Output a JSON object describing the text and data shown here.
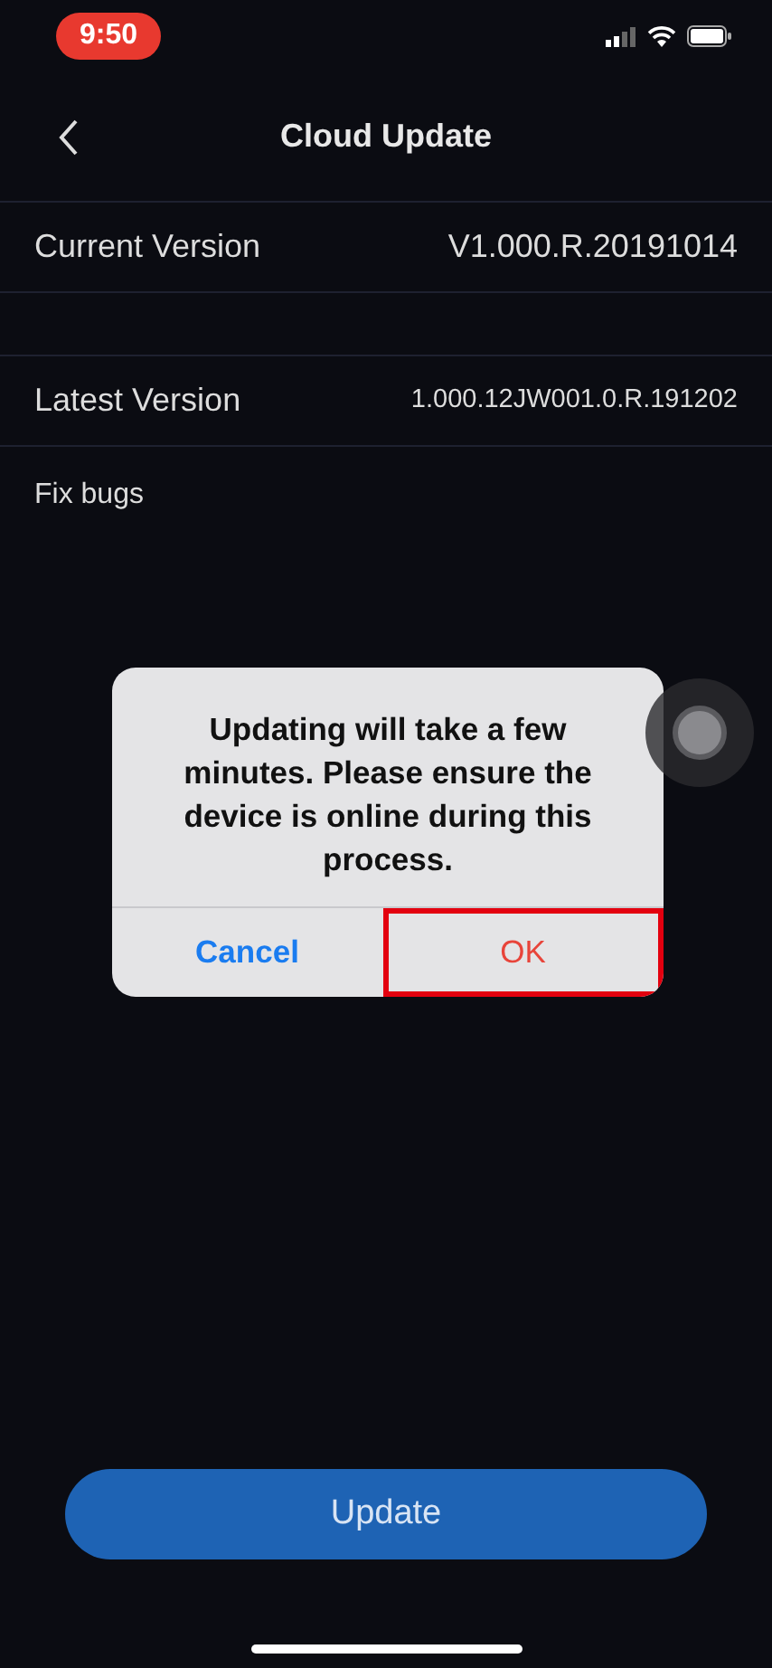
{
  "status_bar": {
    "time": "9:50"
  },
  "nav": {
    "title": "Cloud Update"
  },
  "rows": [
    {
      "label": "Current Version",
      "value": "V1.000.R.20191014"
    },
    {
      "label": "Latest Version",
      "value": "1.000.12JW001.0.R.191202"
    }
  ],
  "notes": "Fix bugs",
  "dialog": {
    "message": "Updating will take a few minutes. Please ensure the device is online during this process.",
    "buttons": [
      {
        "label": "Cancel",
        "kind": "cancel",
        "highlighted": false
      },
      {
        "label": "OK",
        "kind": "confirm",
        "highlighted": true
      }
    ]
  },
  "update_button": {
    "label": "Update"
  }
}
